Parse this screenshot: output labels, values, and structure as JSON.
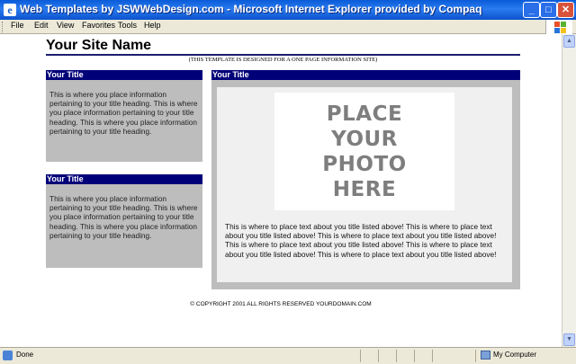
{
  "window": {
    "title": "Web Templates by JSWWebDesign.com - Microsoft Internet Explorer provided by Compaq",
    "minimize_glyph": "_",
    "maximize_glyph": "□",
    "close_glyph": "✕"
  },
  "menu": {
    "items": [
      "File",
      "Edit",
      "View",
      "Favorites",
      "Tools",
      "Help"
    ]
  },
  "page": {
    "site_name": "Your Site Name",
    "subtitle": "(THIS TEMPLATE IS DESIGNED FOR A ONE PAGE INFORMATION SITE)",
    "sidebar": [
      {
        "title": "Your Title",
        "body": "This is where you place information pertaining to your title heading. This is where you place information pertaining to your title heading. This is where you place information pertaining to your title heading."
      },
      {
        "title": "Your Title",
        "body": "This is where you place information pertaining to your title heading. This is where you place information pertaining to your title heading. This is where you place information pertaining to your title heading."
      }
    ],
    "main": {
      "title": "Your Title",
      "photo_text": "PLACE\nYOUR\nPHOTO\nHERE",
      "body": "This is where to place text about you title listed above! This is where to place text about you title listed above! This is where to place text about you title listed above! This is where to place text about you title listed above! This is where to place text about you title listed above! This is where to place text about you title listed above!"
    },
    "copyright": "© COPYRIGHT 2001 ALL RIGHTS RESERVED YOURDOMAIN.COM"
  },
  "status": {
    "text": "Done",
    "zone": "My Computer"
  },
  "colors": {
    "header_bar": "#000078",
    "box_bg": "#bdbdbd",
    "titlebar": "#0a5bd8"
  }
}
